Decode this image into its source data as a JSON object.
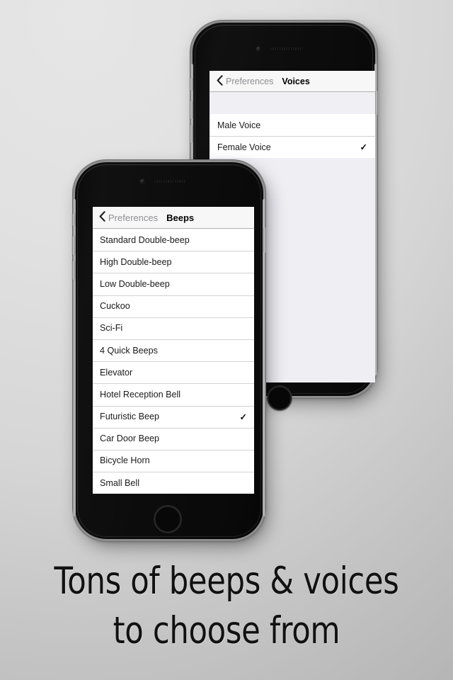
{
  "background": {
    "color_light": "#e6e6e6",
    "color_dark": "#b4b4b4"
  },
  "caption": {
    "line1": "Tons of beeps & voices",
    "line2": "to choose from"
  },
  "phone_back": {
    "device": "iPhone (space gray)",
    "screen": {
      "navbar": {
        "back_label": "Preferences",
        "back_icon": "chevron-left-icon",
        "title": "Voices"
      },
      "rows": [
        {
          "label": "Male Voice",
          "checked": false,
          "check": ""
        },
        {
          "label": "Female Voice",
          "checked": true,
          "check": "✓"
        }
      ]
    }
  },
  "phone_front": {
    "device": "iPhone (space gray)",
    "screen": {
      "navbar": {
        "back_label": "Preferences",
        "back_icon": "chevron-left-icon",
        "title": "Beeps"
      },
      "rows": [
        {
          "label": "Standard Double-beep",
          "checked": false,
          "check": ""
        },
        {
          "label": "High Double-beep",
          "checked": false,
          "check": ""
        },
        {
          "label": "Low Double-beep",
          "checked": false,
          "check": ""
        },
        {
          "label": "Cuckoo",
          "checked": false,
          "check": ""
        },
        {
          "label": "Sci-Fi",
          "checked": false,
          "check": ""
        },
        {
          "label": "4 Quick Beeps",
          "checked": false,
          "check": ""
        },
        {
          "label": "Elevator",
          "checked": false,
          "check": ""
        },
        {
          "label": "Hotel Reception Bell",
          "checked": false,
          "check": ""
        },
        {
          "label": "Futuristic Beep",
          "checked": true,
          "check": "✓"
        },
        {
          "label": "Car Door Beep",
          "checked": false,
          "check": ""
        },
        {
          "label": "Bicycle Horn",
          "checked": false,
          "check": ""
        },
        {
          "label": "Small Bell",
          "checked": false,
          "check": ""
        }
      ]
    }
  }
}
